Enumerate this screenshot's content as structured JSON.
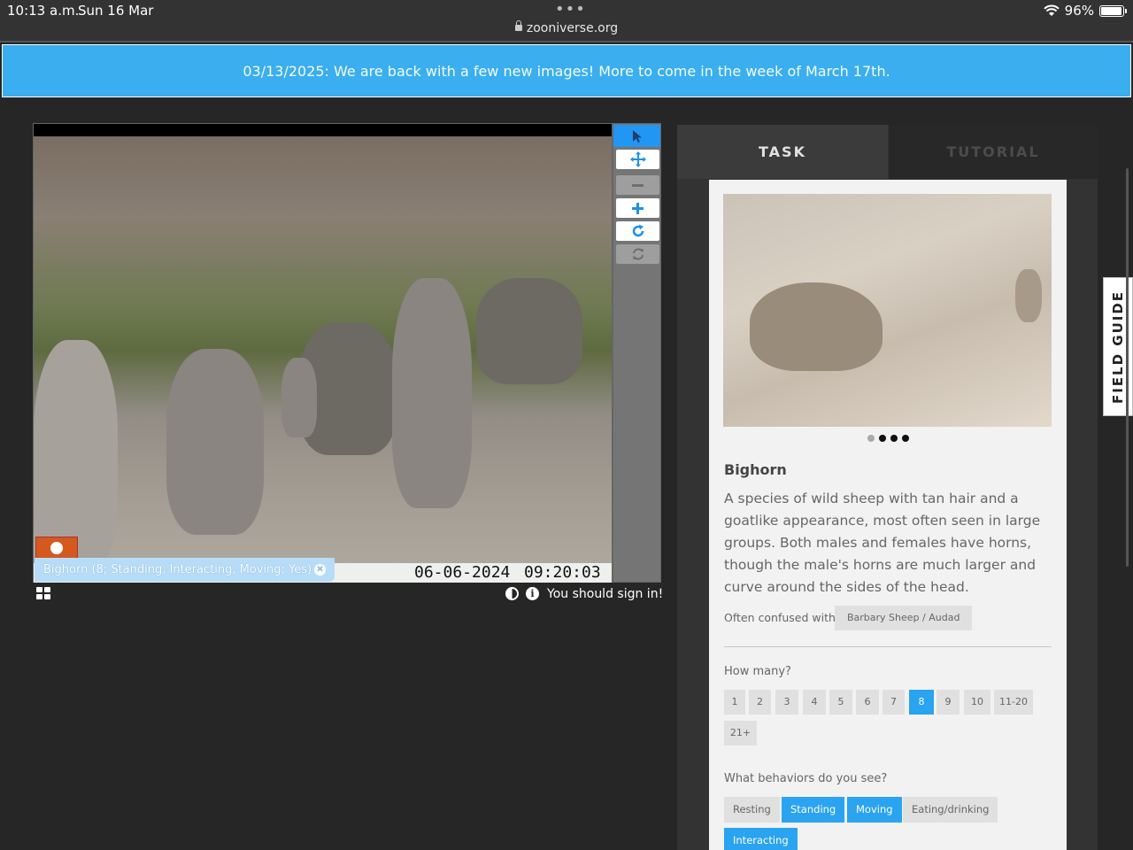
{
  "status_bar": {
    "time": "10:13 a.m.",
    "date": "Sun 16 Mar",
    "url": "zooniverse.org",
    "battery": "96%",
    "battery_level": 0.96
  },
  "announcement": {
    "text": "03/13/2025: We are back with a few new images! More to come in the week of March 17th."
  },
  "viewer": {
    "date_stamp": "06-06-2024",
    "time_stamp": "09:20:03",
    "annotation_label": "Bighorn (8; Standing, Interacting, Moving; Yes)",
    "tools": [
      "pointer-icon",
      "move-icon",
      "zoom-out-icon",
      "zoom-in-icon",
      "rotate-icon",
      "reset-icon"
    ]
  },
  "below_viewer": {
    "signin_message": "You should sign in!"
  },
  "tabs": {
    "task": "TASK",
    "tutorial": "TUTORIAL"
  },
  "field_guide": {
    "label": "FIELD GUIDE"
  },
  "species": {
    "name": "Bighorn",
    "description": "A species of wild sheep with tan hair and a goatlike appearance, most often seen in large groups. Both males and females have horns, though the male's horns are much larger and curve around the sides of the head.",
    "confused_label": "Often confused with",
    "confused_with": "Barbary Sheep / Audad"
  },
  "questions": {
    "how_many": {
      "label": "How many?",
      "options": [
        "1",
        "2",
        "3",
        "4",
        "5",
        "6",
        "7",
        "8",
        "9",
        "10",
        "11-20",
        "21+"
      ],
      "selected": "8"
    },
    "behaviors": {
      "label": "What behaviors do you see?",
      "options": [
        "Resting",
        "Standing",
        "Moving",
        "Eating/drinking",
        "Interacting"
      ],
      "selected": [
        "Standing",
        "Moving",
        "Interacting"
      ]
    }
  }
}
